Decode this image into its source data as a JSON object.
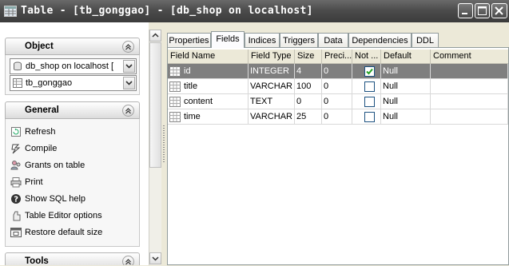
{
  "window": {
    "title": "Table - [tb_gonggao] - [db_shop on localhost]",
    "buttons": [
      "minimize",
      "maximize",
      "close"
    ]
  },
  "sidebar": {
    "object_section": {
      "title": "Object",
      "database_combo": "db_shop on localhost [",
      "table_combo": "tb_gonggao"
    },
    "general_section": {
      "title": "General",
      "actions": [
        {
          "label": "Refresh",
          "icon": "refresh-icon"
        },
        {
          "label": "Compile",
          "icon": "compile-icon"
        },
        {
          "label": "Grants on table",
          "icon": "grants-icon"
        },
        {
          "label": "Print",
          "icon": "print-icon"
        },
        {
          "label": "Show SQL help",
          "icon": "help-icon"
        },
        {
          "label": "Table Editor options",
          "icon": "options-icon"
        },
        {
          "label": "Restore default size",
          "icon": "restore-size-icon"
        }
      ]
    },
    "tools_section": {
      "title": "Tools"
    }
  },
  "tabs": [
    {
      "label": "Properties",
      "active": false
    },
    {
      "label": "Fields",
      "active": true
    },
    {
      "label": "Indices",
      "active": false
    },
    {
      "label": "Triggers",
      "active": false
    },
    {
      "label": "Data",
      "active": false
    },
    {
      "label": "Dependencies",
      "active": false
    },
    {
      "label": "DDL",
      "active": false
    }
  ],
  "fields_grid": {
    "columns": [
      "Field Name",
      "Field Type",
      "Size",
      "Preci...",
      "Not ...",
      "Default",
      "Comment"
    ],
    "rows": [
      {
        "name": "id",
        "type": "INTEGER",
        "size": "4",
        "precision": "0",
        "not_null": true,
        "default": "Null",
        "comment": "",
        "selected": true
      },
      {
        "name": "title",
        "type": "VARCHAR",
        "size": "100",
        "precision": "0",
        "not_null": false,
        "default": "Null",
        "comment": "",
        "selected": false
      },
      {
        "name": "content",
        "type": "TEXT",
        "size": "0",
        "precision": "0",
        "not_null": false,
        "default": "Null",
        "comment": "",
        "selected": false
      },
      {
        "name": "time",
        "type": "VARCHAR",
        "size": "25",
        "precision": "0",
        "not_null": false,
        "default": "Null",
        "comment": "",
        "selected": false
      }
    ]
  },
  "colors": {
    "selected_row": "#7f7f7f",
    "titlebar": "#4c4c4c",
    "panel_bg": "#ece9d8"
  }
}
